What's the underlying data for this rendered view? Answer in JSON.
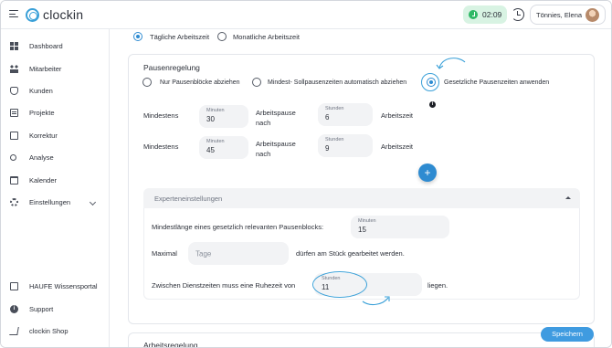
{
  "header": {
    "logo_text": "clockin",
    "timer": "02:09",
    "user_name": "Tönnies, Elena"
  },
  "sidebar": {
    "items": [
      {
        "label": "Dashboard",
        "icon": "dashboard-icon"
      },
      {
        "label": "Mitarbeiter",
        "icon": "users-icon"
      },
      {
        "label": "Kunden",
        "icon": "handshake-icon"
      },
      {
        "label": "Projekte",
        "icon": "projects-icon"
      },
      {
        "label": "Korrektur",
        "icon": "edit-icon"
      },
      {
        "label": "Analyse",
        "icon": "search-icon"
      },
      {
        "label": "Kalender",
        "icon": "calendar-icon"
      },
      {
        "label": "Einstellungen",
        "icon": "gear-icon"
      }
    ],
    "bottom_items": [
      {
        "label": "HAUFE Wissensportal",
        "icon": "book-icon"
      },
      {
        "label": "Support",
        "icon": "info-icon"
      },
      {
        "label": "clockin Shop",
        "icon": "cart-icon"
      }
    ]
  },
  "main": {
    "time_mode": {
      "daily": "Tägliche Arbeitszeit",
      "monthly": "Monatliche Arbeitszeit"
    },
    "pause": {
      "title": "Pausenregelung",
      "options": [
        "Nur Pausenblöcke abziehen",
        "Mindest- Sollpausenzeiten automatisch abziehen",
        "Gesetzliche Pausenzeiten anwenden"
      ],
      "rules": [
        {
          "prefix": "Mindestens",
          "minutes_label": "Minuten",
          "minutes_value": "30",
          "middle": "Arbeitspause",
          "middle2": "nach",
          "hours_label": "Stunden",
          "hours_value": "6",
          "suffix": "Arbeitszeit"
        },
        {
          "prefix": "Mindestens",
          "minutes_label": "Minuten",
          "minutes_value": "45",
          "middle": "Arbeitspause",
          "middle2": "nach",
          "hours_label": "Stunden",
          "hours_value": "9",
          "suffix": "Arbeitszeit"
        }
      ],
      "plus": "+"
    },
    "expert": {
      "title": "Experteneinstellungen",
      "min_length_label": "Mindestlänge eines gesetzlich relevanten Pausenblocks:",
      "min_length_field_label": "Minuten",
      "min_length_value": "15",
      "max_label": "Maximal",
      "max_placeholder": "Tage",
      "max_suffix": "dürfen am Stück gearbeitet werden.",
      "rest_label": "Zwischen Dienstzeiten muss eine Ruhezeit von",
      "rest_field_label": "Stunden",
      "rest_value": "11",
      "rest_suffix": "liegen."
    },
    "next_section_title": "Arbeitsregelung",
    "save_label": "Speichern"
  },
  "colors": {
    "accent": "#2e8bd1",
    "timer_bg": "#d8f3e3",
    "timer_dot": "#2fb866"
  }
}
